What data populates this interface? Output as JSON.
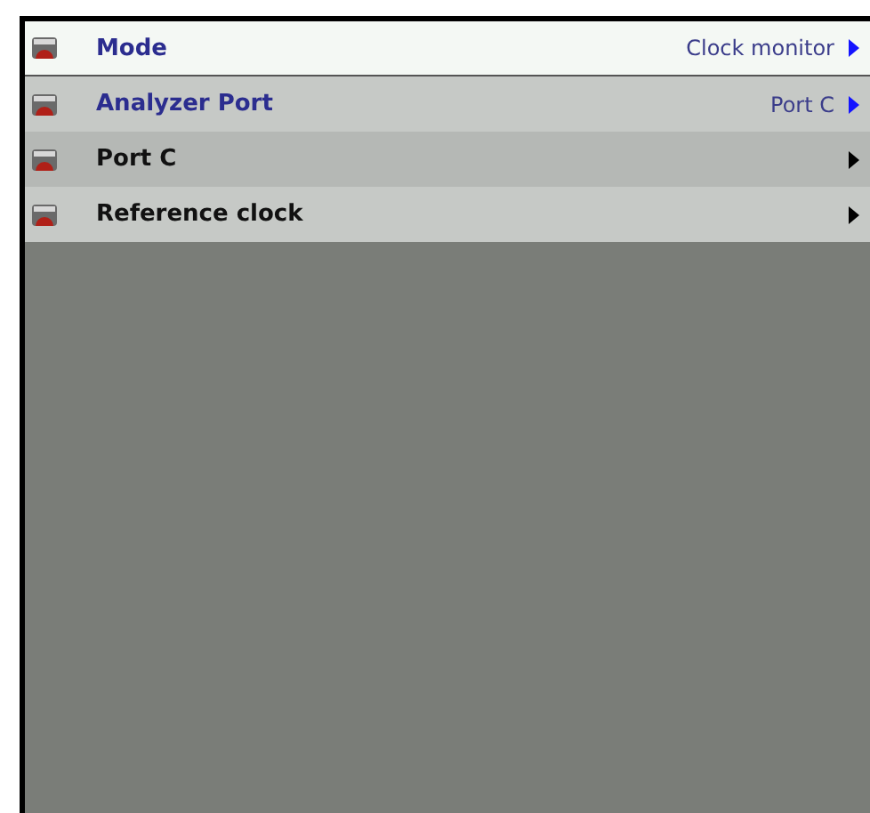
{
  "menu": {
    "items": [
      {
        "label": "Mode",
        "value": "Clock monitor",
        "kind": "value",
        "selected": true
      },
      {
        "label": "Analyzer Port",
        "value": "Port C",
        "kind": "value",
        "selected": false
      },
      {
        "label": "Port C",
        "kind": "submenu",
        "selected": false
      },
      {
        "label": "Reference clock",
        "kind": "submenu",
        "selected": false
      }
    ]
  }
}
